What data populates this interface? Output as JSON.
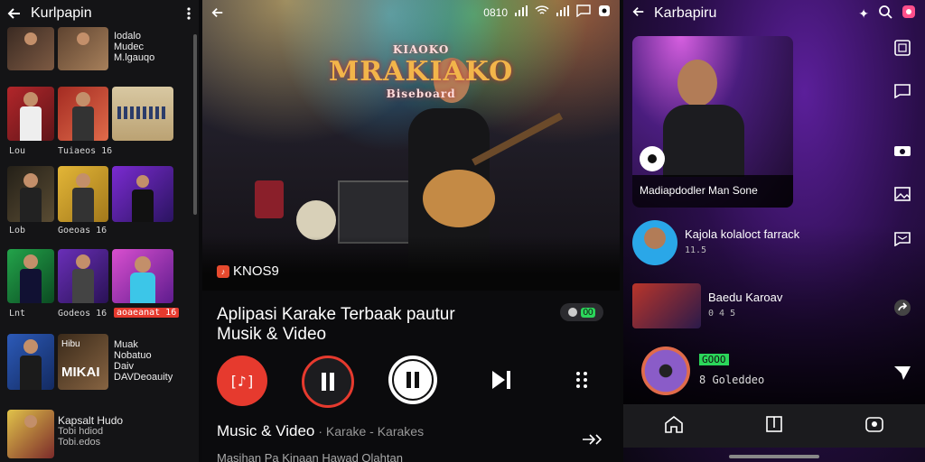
{
  "left": {
    "title": "Kurlpapin",
    "rows": [
      {
        "captions": [
          "Iodalo",
          "Mudec",
          "M.lgauqo"
        ]
      },
      {
        "captions": [
          "Lou",
          "Tuiaeos 16"
        ]
      },
      {
        "captions": [
          "Lob",
          "Goeoas 16"
        ]
      },
      {
        "captions": [
          "Lnt",
          "Godeos 16",
          "aoaeanat 16"
        ]
      },
      {
        "captions": [
          "Muak",
          "Nobatuo",
          "Daiv",
          "DAVDeoauity"
        ],
        "thumb_text": [
          "Hibu",
          "MIKAI"
        ]
      },
      {
        "captions": [
          "Kapsalt Hudo",
          "Tobi hdiod",
          "Tobi.edos"
        ]
      }
    ]
  },
  "mid": {
    "status_time": "0810",
    "stage_sign": "MRAKIAKO",
    "stage_sign_top": "KIAOKO",
    "stage_sign_sub": "Biseboard",
    "logo_label": "KNOS9",
    "title_line1": "Aplipasi Karake Terbaak pautur",
    "title_line2": "Musik & Video",
    "pill_text": "00",
    "footer_main": "Music & Video",
    "footer_sub": "· Karake - Karakes",
    "bottom_cut": "Masihan Pa Kinaan Hawad  Olahtan"
  },
  "right": {
    "title": "Karbapiru",
    "card_caption": "Madiapdodler Man Sone",
    "items": [
      {
        "title": "Kajola kolaloct farrack",
        "sub": "11.5"
      },
      {
        "title": "Baedu Karoav",
        "sub": "0 4 5"
      },
      {
        "title": "",
        "sub": "8 Goleddeo",
        "badge": "GOOO"
      }
    ]
  },
  "colors": {
    "accent_red": "#e63a2e",
    "accent_green": "#2bd65a",
    "bg_dark": "#0b0b0d"
  }
}
